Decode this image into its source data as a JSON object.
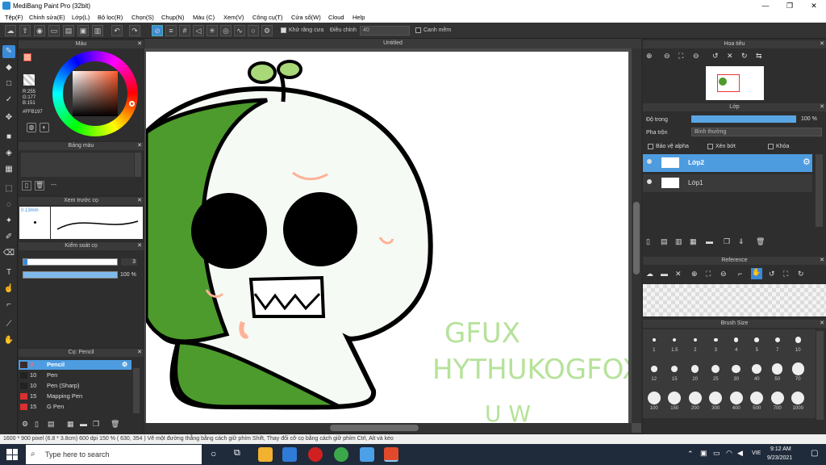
{
  "window": {
    "title": "MediBang Paint Pro (32bit)",
    "minimize": "—",
    "maximize": "❐",
    "close": "✕"
  },
  "menu": [
    "Tệp(F)",
    "Chỉnh sửa(E)",
    "Lớp(L)",
    "Bộ lọc(R)",
    "Chọn(S)",
    "Chụp(N)",
    "Màu (C)",
    "Xem(V)",
    "Công cụ(T)",
    "Cửa sổ(W)",
    "Cloud",
    "Help"
  ],
  "toolbar": {
    "antialias_label": "Khử răng cưa",
    "correction_label": "Điều chỉnh",
    "correction_value": "40",
    "canh_mem_label": "Canh mềm"
  },
  "color_panel": {
    "title": "Màu",
    "r": "R:255",
    "g": "G:177",
    "b": "B:151",
    "hex": "#FFB197",
    "accent": "#FFB197"
  },
  "palette_panel": {
    "title": "Bảng màu",
    "value": "---"
  },
  "preview_panel": {
    "title": "Xem trước cọ",
    "size": "0.13mm"
  },
  "brush_control": {
    "title": "Kiểm soát cọ",
    "size_value": "3",
    "opacity_value": "100 %"
  },
  "brush_list": {
    "title": "Cọ: Pencil",
    "items": [
      {
        "size": "3",
        "name": "Pencil",
        "color": "#3c2a2a",
        "selected": true
      },
      {
        "size": "10",
        "name": "Pen",
        "color": "#222222",
        "selected": false
      },
      {
        "size": "10",
        "name": "Pen (Sharp)",
        "color": "#222222",
        "selected": false
      },
      {
        "size": "15",
        "name": "Mapping Pen",
        "color": "#d93030",
        "selected": false
      },
      {
        "size": "15",
        "name": "G Pen",
        "color": "#d93030",
        "selected": false
      }
    ]
  },
  "canvas": {
    "tab_title": "Untitled",
    "art_text_1": "GFUX",
    "art_text_2": "HYTHUKOGFOX",
    "art_text_3": "U W"
  },
  "navigator": {
    "title": "Hoa tiêu"
  },
  "layers": {
    "title": "Lớp",
    "opacity_label": "Độ trong",
    "opacity_value": "100 %",
    "blend_label": "Pha trộn",
    "blend_value": "Bình thường",
    "protect_alpha": "Bảo vệ alpha",
    "clipping": "Xén bớt",
    "lock": "Khóa",
    "items": [
      {
        "name": "Lớp2",
        "selected": true
      },
      {
        "name": "Lớp1",
        "selected": false
      }
    ]
  },
  "reference": {
    "title": "Reference"
  },
  "brush_size": {
    "title": "Brush Size",
    "sizes": [
      "1",
      "1.5",
      "2",
      "3",
      "4",
      "5",
      "7",
      "10",
      "12",
      "15",
      "20",
      "25",
      "30",
      "40",
      "50",
      "70",
      "100",
      "150",
      "200",
      "300",
      "400",
      "500",
      "700",
      "1000"
    ]
  },
  "status": {
    "text": "1600 * 900 pixel  (6.8 * 3.8cm)  600 dpi  150 %  ( 630, 354 )  Vẽ một đường thẳng bằng cách giữ phím Shift, Thay đổi cỡ cọ bằng cách giữ phím Ctrl, Alt và kéo"
  },
  "taskbar": {
    "search_placeholder": "Type here to search",
    "language": "VIE",
    "time": "9:12 AM",
    "date": "9/23/2021"
  }
}
